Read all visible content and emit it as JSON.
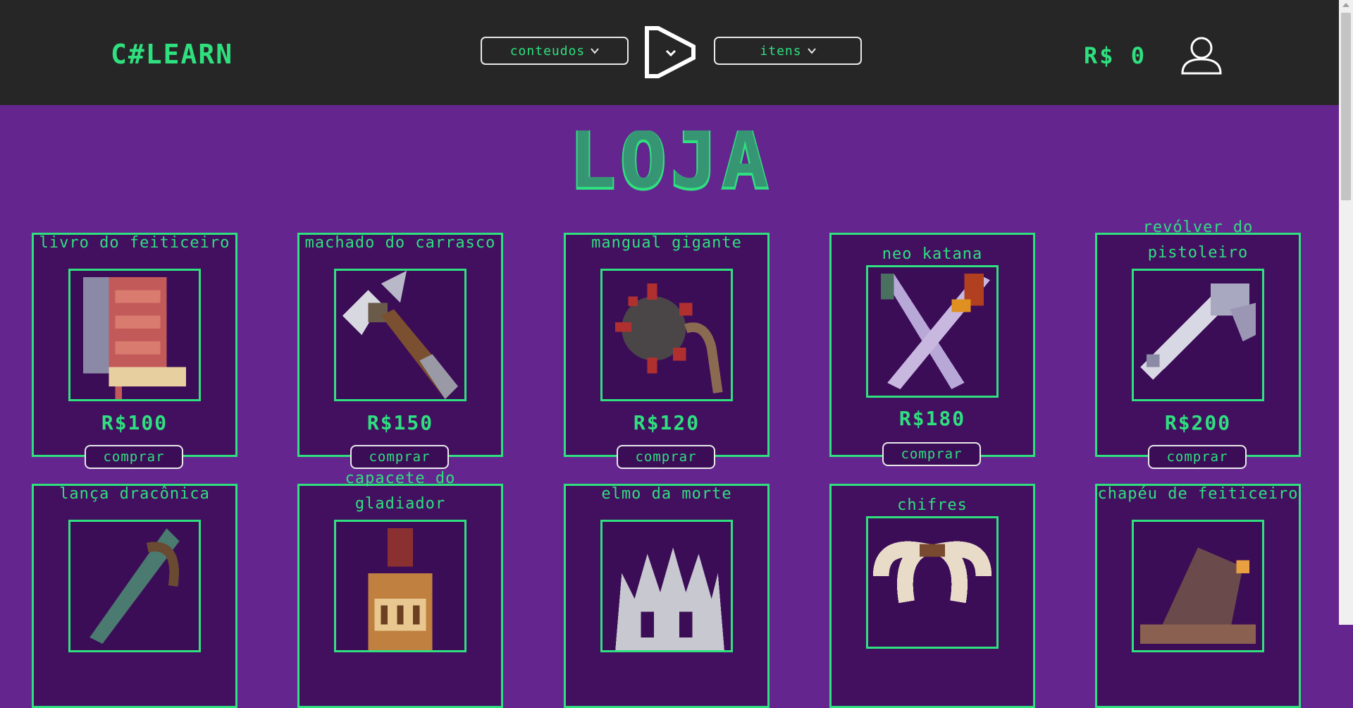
{
  "header": {
    "brand": "C#LEARN",
    "nav": {
      "conteudos_label": "conteudos",
      "itens_label": "itens"
    },
    "coins": "R$ 0"
  },
  "page": {
    "title": "LOJA"
  },
  "products_row1": [
    {
      "name": "Livro do Feiticeiro",
      "price": "R$100",
      "buy": "comprar",
      "icon": "spellbook-icon"
    },
    {
      "name": "Machado do Carrasco",
      "price": "R$150",
      "buy": "comprar",
      "icon": "axe-icon"
    },
    {
      "name": "Mangual Gigante",
      "price": "R$120",
      "buy": "comprar",
      "icon": "flail-icon"
    },
    {
      "name": "Neo Katana",
      "price": "R$180",
      "buy": "comprar",
      "icon": "katana-icon"
    },
    {
      "name": "Revólver do Pistoleiro",
      "price": "R$200",
      "buy": "comprar",
      "icon": "revolver-icon"
    }
  ],
  "products_row2": [
    {
      "name": "Lança Dracônica",
      "icon": "spear-icon"
    },
    {
      "name": "Capacete do Gladiador",
      "icon": "gladiator-helmet-icon"
    },
    {
      "name": "Elmo da Morte",
      "icon": "death-helm-icon"
    },
    {
      "name": "Chifres",
      "icon": "horns-icon"
    },
    {
      "name": "Chapéu de Feiticeiro",
      "icon": "wizard-hat-icon"
    }
  ],
  "colors": {
    "accent": "#2fe07f",
    "background": "#65258f",
    "card": "#431060",
    "header": "#262626"
  }
}
